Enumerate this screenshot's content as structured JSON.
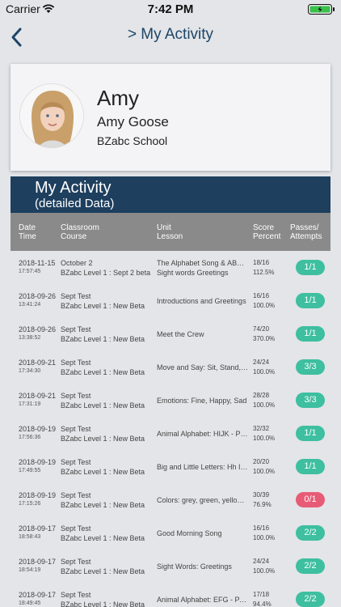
{
  "status_bar": {
    "carrier": "Carrier",
    "time": "7:42 PM"
  },
  "nav": {
    "title": "> My Activity",
    "back_icon": "chevron-left-icon"
  },
  "profile": {
    "first_name": "Amy",
    "full_name": "Amy Goose",
    "school": "BZabc School"
  },
  "activity": {
    "title": "My Activity",
    "subtitle": "(detailed Data)"
  },
  "table": {
    "headers": {
      "date_time": [
        "Date",
        "Time"
      ],
      "classroom_course": [
        "Classroom",
        "Course"
      ],
      "unit_lesson": [
        "Unit",
        "Lesson"
      ],
      "score_percent": [
        "Score",
        "Percent"
      ],
      "passes_attempts": [
        "Passes/",
        "Attempts"
      ]
    },
    "rows": [
      {
        "date": "2018-11-15",
        "time": "17:57:45",
        "classroom": "October 2",
        "course": "BZabc Level 1 : Sept 2 beta",
        "unit": "The Alphabet Song & ABC Ch...",
        "lesson": "Sight words Greetings",
        "score": "18/16",
        "percent": "112.5%",
        "passes": "1/1",
        "status": "pass"
      },
      {
        "date": "2018-09-26",
        "time": "13:41:24",
        "classroom": "Sept Test",
        "course": "BZabc Level 1 : New Beta",
        "unit": "",
        "lesson": "Introductions and Greetings",
        "score": "16/16",
        "percent": "100.0%",
        "passes": "1/1",
        "status": "pass"
      },
      {
        "date": "2018-09-26",
        "time": "13:38:52",
        "classroom": "Sept Test",
        "course": "BZabc Level 1 : New Beta",
        "unit": "",
        "lesson": "Meet the Crew",
        "score": "74/20",
        "percent": "370.0%",
        "passes": "1/1",
        "status": "pass"
      },
      {
        "date": "2018-09-21",
        "time": "17:34:30",
        "classroom": "Sept Test",
        "course": "BZabc Level 1 : New Beta",
        "unit": "",
        "lesson": "Move and Say: Sit, Stand, Jump",
        "score": "24/24",
        "percent": "100.0%",
        "passes": "3/3",
        "status": "pass"
      },
      {
        "date": "2018-09-21",
        "time": "17:31:19",
        "classroom": "Sept Test",
        "course": "BZabc Level 1 : New Beta",
        "unit": "",
        "lesson": "Emotions:  Fine, Happy, Sad",
        "score": "28/28",
        "percent": "100.0%",
        "passes": "3/3",
        "status": "pass"
      },
      {
        "date": "2018-09-19",
        "time": "17:56:36",
        "classroom": "Sept Test",
        "course": "BZabc Level 1 : New Beta",
        "unit": "",
        "lesson": "Animal Alphabet: HIJK - Part 1",
        "score": "32/32",
        "percent": "100.0%",
        "passes": "1/1",
        "status": "pass"
      },
      {
        "date": "2018-09-19",
        "time": "17:49:55",
        "classroom": "Sept Test",
        "course": "BZabc Level 1 : New Beta",
        "unit": "",
        "lesson": "Big and Little Letters: Hh Ii Jj",
        "score": "20/20",
        "percent": "100.0%",
        "passes": "1/1",
        "status": "pass"
      },
      {
        "date": "2018-09-19",
        "time": "17:15:26",
        "classroom": "Sept Test",
        "course": "BZabc Level 1 : New Beta",
        "unit": "",
        "lesson": "Colors: grey, green, yellow, red",
        "score": "30/39",
        "percent": "76.9%",
        "passes": "0/1",
        "status": "fail"
      },
      {
        "date": "2018-09-17",
        "time": "18:58:43",
        "classroom": "Sept Test",
        "course": "BZabc Level 1 : New Beta",
        "unit": "",
        "lesson": "Good Morning Song",
        "score": "16/16",
        "percent": "100.0%",
        "passes": "2/2",
        "status": "pass"
      },
      {
        "date": "2018-09-17",
        "time": "18:54:19",
        "classroom": "Sept Test",
        "course": "BZabc Level 1 : New Beta",
        "unit": "",
        "lesson": "Sight Words: Greetings",
        "score": "24/24",
        "percent": "100.0%",
        "passes": "2/2",
        "status": "pass"
      },
      {
        "date": "2018-09-17",
        "time": "18:49:45",
        "classroom": "Sept Test",
        "course": "BZabc Level 1 : New Beta",
        "unit": "",
        "lesson": "Animal Alphabet: EFG - PART 1",
        "score": "17/18",
        "percent": "94.4%",
        "passes": "2/2",
        "status": "pass"
      }
    ]
  },
  "colors": {
    "pass": "#3dbfa0",
    "fail": "#e85b76",
    "header_bg": "#1e3f5e",
    "table_header_bg": "#8a8a8a"
  }
}
